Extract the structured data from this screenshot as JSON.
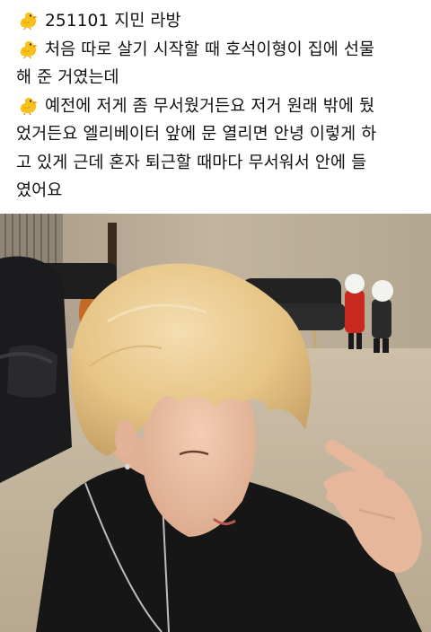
{
  "caption": {
    "line1": "251101 지민 라방",
    "line2": "처음 따로 살기 시작할 때 호석이형이 집에 선물",
    "line3": "해 준 거였는데",
    "line4": "예전에 저게 좀 무서웠거든요 저거 원래 밖에 뒀",
    "line5": "었거든요 엘리베이터 앞에 문 열리면 안녕 이렇게 하",
    "line6": "고 있게 근데 혼자 퇴근할 때마다 무서워서 안에 들",
    "line7": "였어요"
  },
  "icons": {
    "bullet": "baby-chick-emoji"
  },
  "colors": {
    "text": "#111111",
    "chick_yellow": "#f7c21b",
    "chick_beak": "#f08a10",
    "hair": "#e8c989",
    "wall": "#b8aa95",
    "shirt": "#161616"
  }
}
